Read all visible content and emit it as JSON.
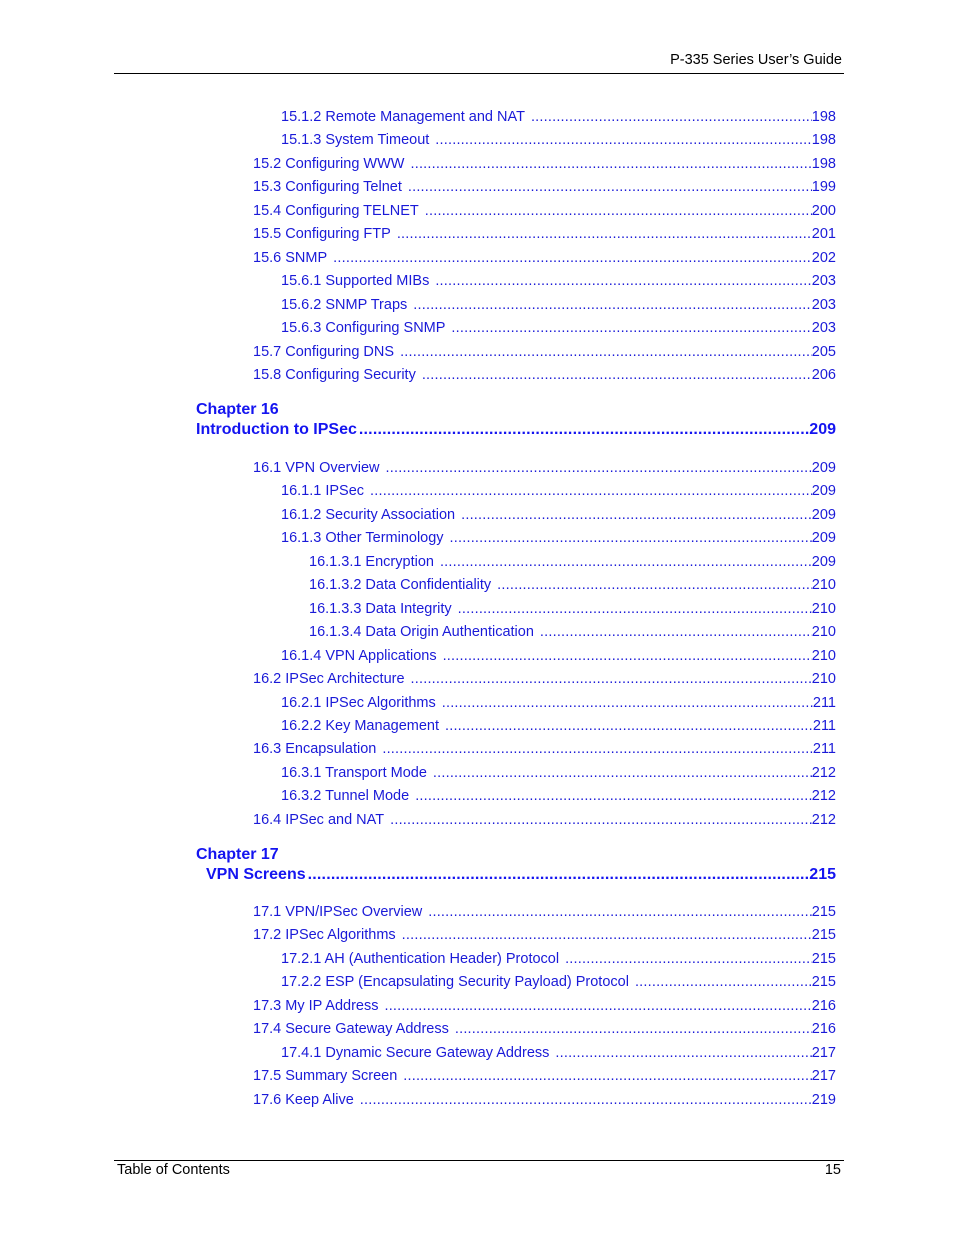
{
  "header": {
    "title": "P-335 Series User’s Guide"
  },
  "footer": {
    "section": "Table of Contents",
    "page_number": "15"
  },
  "colors": {
    "link": "#1a1ad8",
    "chapter": "#1414f0"
  },
  "groups": [
    {
      "entries": [
        {
          "level": 2,
          "title": "15.1.2 Remote Management and NAT",
          "page": "198"
        },
        {
          "level": 2,
          "title": "15.1.3  System Timeout",
          "page": "198"
        },
        {
          "level": 1,
          "title": "15.2 Configuring WWW",
          "page": "198"
        },
        {
          "level": 1,
          "title": "15.3 Configuring Telnet",
          "page": "199"
        },
        {
          "level": 1,
          "title": "15.4 Configuring TELNET",
          "page": "200"
        },
        {
          "level": 1,
          "title": "15.5 Configuring FTP",
          "page": "201"
        },
        {
          "level": 1,
          "title": "15.6 SNMP",
          "page": "202"
        },
        {
          "level": 2,
          "title": "15.6.1 Supported MIBs",
          "page": "203"
        },
        {
          "level": 2,
          "title": "15.6.2 SNMP Traps",
          "page": "203"
        },
        {
          "level": 2,
          "title": "15.6.3 Configuring SNMP",
          "page": "203"
        },
        {
          "level": 1,
          "title": "15.7 Configuring DNS",
          "page": "205"
        },
        {
          "level": 1,
          "title": "15.8 Configuring Security",
          "page": "206"
        }
      ]
    },
    {
      "chapter": "Chapter 16",
      "chapter_title": "Introduction to IPSec",
      "chapter_page": "209",
      "entries": [
        {
          "level": 1,
          "title": "16.1 VPN Overview",
          "page": "209"
        },
        {
          "level": 2,
          "title": "16.1.1 IPSec",
          "page": "209"
        },
        {
          "level": 2,
          "title": "16.1.2 Security Association",
          "page": "209"
        },
        {
          "level": 2,
          "title": "16.1.3 Other Terminology",
          "page": "209"
        },
        {
          "level": 3,
          "title": "16.1.3.1 Encryption",
          "page": "209"
        },
        {
          "level": 3,
          "title": "16.1.3.2 Data Confidentiality",
          "page": "210"
        },
        {
          "level": 3,
          "title": "16.1.3.3 Data Integrity",
          "page": "210"
        },
        {
          "level": 3,
          "title": "16.1.3.4 Data Origin Authentication",
          "page": "210"
        },
        {
          "level": 2,
          "title": "16.1.4 VPN Applications",
          "page": "210"
        },
        {
          "level": 1,
          "title": "16.2 IPSec Architecture",
          "page": "210"
        },
        {
          "level": 2,
          "title": "16.2.1 IPSec Algorithms",
          "page": "211"
        },
        {
          "level": 2,
          "title": "16.2.2 Key Management",
          "page": "211"
        },
        {
          "level": 1,
          "title": "16.3 Encapsulation",
          "page": "211"
        },
        {
          "level": 2,
          "title": "16.3.1 Transport Mode",
          "page": "212"
        },
        {
          "level": 2,
          "title": "16.3.2 Tunnel Mode",
          "page": "212"
        },
        {
          "level": 1,
          "title": "16.4 IPSec and NAT",
          "page": "212"
        }
      ]
    },
    {
      "chapter": "Chapter 17",
      "chapter_title": "VPN Screens",
      "chapter_page": "215",
      "entries": [
        {
          "level": 1,
          "title": "17.1 VPN/IPSec Overview",
          "page": "215"
        },
        {
          "level": 1,
          "title": "17.2 IPSec Algorithms",
          "page": "215"
        },
        {
          "level": 2,
          "title": "17.2.1 AH (Authentication Header) Protocol",
          "page": "215"
        },
        {
          "level": 2,
          "title": "17.2.2 ESP (Encapsulating Security Payload) Protocol",
          "page": "215"
        },
        {
          "level": 1,
          "title": "17.3 My IP Address",
          "page": "216"
        },
        {
          "level": 1,
          "title": "17.4 Secure Gateway Address",
          "page": "216"
        },
        {
          "level": 2,
          "title": "17.4.1 Dynamic Secure Gateway Address",
          "page": "217"
        },
        {
          "level": 1,
          "title": "17.5 Summary Screen",
          "page": "217"
        },
        {
          "level": 1,
          "title": "17.6 Keep Alive",
          "page": "219"
        }
      ]
    }
  ]
}
